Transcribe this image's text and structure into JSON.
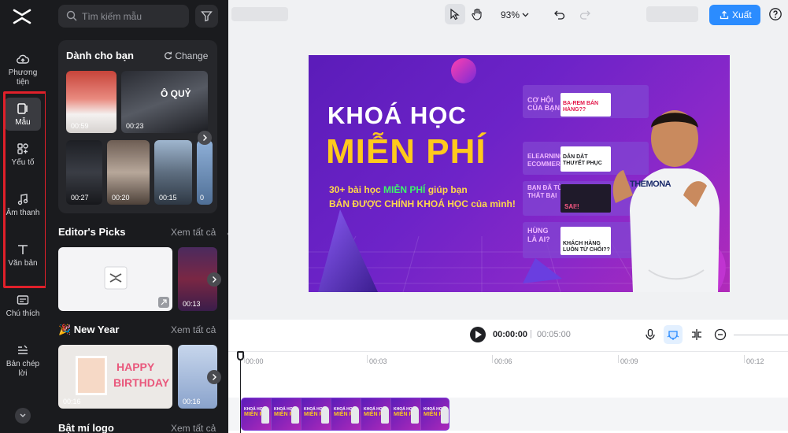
{
  "rail": {
    "items": [
      {
        "label": "Phương tiện"
      },
      {
        "label": "Mẫu"
      },
      {
        "label": "Yếu tố"
      },
      {
        "label": "Âm thanh"
      },
      {
        "label": "Văn bản"
      },
      {
        "label": "Chú thích"
      },
      {
        "label": "Bản chép lời"
      }
    ]
  },
  "panel": {
    "search_placeholder": "Tìm kiếm mẫu",
    "for_you": {
      "title": "Dành cho bạn",
      "change_label": "Change",
      "thumbs": [
        {
          "duration": "00:59"
        },
        {
          "duration": "00:23",
          "caption": "Ô QUỶ"
        },
        {
          "duration": "00:27"
        },
        {
          "duration": "00:20"
        },
        {
          "duration": "00:15"
        },
        {
          "duration": "0"
        }
      ]
    },
    "editors_picks": {
      "title": "Editor's Picks",
      "link": "Xem tất cả",
      "thumbs": [
        {
          "duration": ""
        },
        {
          "duration": "00:13"
        }
      ]
    },
    "new_year": {
      "title": "🎉 New Year",
      "link": "Xem tất cả",
      "thumbs": [
        {
          "duration": "00:16",
          "caption1": "HAPPY",
          "caption2": "BIRTHDAY"
        },
        {
          "duration": "00:16"
        }
      ]
    },
    "logo_reveal": {
      "title": "Bật mí logo",
      "link": "Xem tất cả"
    }
  },
  "topbar": {
    "zoom": "93%",
    "export_label": "Xuất"
  },
  "canvas": {
    "line1": "KHOÁ HỌC",
    "line2": "MIỄN PHÍ",
    "sub_a": "30+ bài học ",
    "sub_highlight": "MIỄN PHÍ",
    "sub_b": " giúp bạn",
    "sub2": "BÁN ĐƯỢC CHÍNH KHOÁ HỌC của mình!",
    "cards": [
      {
        "title": "CƠ HỘI CỦA BẠN",
        "tag": "BA-REM BÁN HÀNG??"
      },
      {
        "title": "ELEARNING ECOMMERCE",
        "tag": "DẪN DẮT THUYẾT PHỤC"
      },
      {
        "title": "BẠN ĐÃ TỪ THẤT BẠI",
        "tag": "SAI!!"
      },
      {
        "title": "HÙNG LÀ AI?",
        "tag": "KHÁCH HÀNG LUÔN TỪ CHỐI??"
      }
    ],
    "shirt_text": "THEMONA"
  },
  "timeline": {
    "current_time": "00:00:00",
    "separator": "|",
    "total_time": "00:05:00",
    "ticks": [
      "00:00",
      "00:03",
      "00:06",
      "00:09",
      "00:12"
    ],
    "clip_tile_line1": "KHOÁ HỌC",
    "clip_tile_line2": "MIỄN PHÍ"
  },
  "colors": {
    "accent": "#2b8cff",
    "highlight_box": "#e0202a",
    "canvas_yellow": "#ffc91c",
    "canvas_green": "#3ef56a"
  }
}
